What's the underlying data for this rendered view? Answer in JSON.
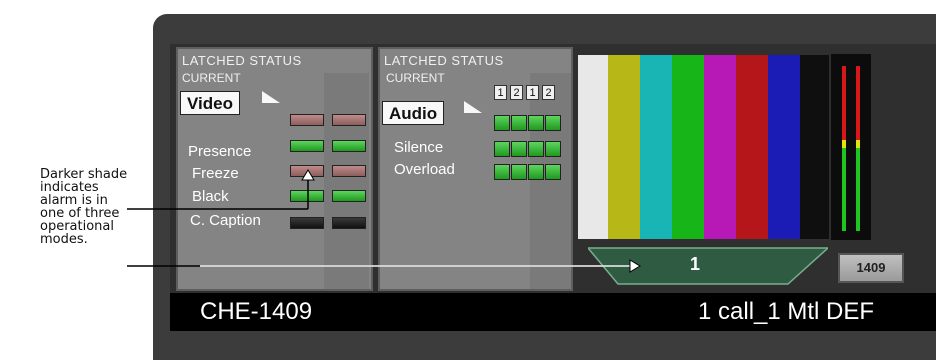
{
  "callout": {
    "lines": [
      "Darker shade",
      "indicates",
      "alarm is in",
      "one of three",
      "operational",
      "modes."
    ]
  },
  "video_panel": {
    "header": "LATCHED STATUS",
    "current": "CURRENT",
    "tab": "Video",
    "rows": [
      "Presence",
      "Freeze",
      "Black",
      "C. Caption"
    ]
  },
  "audio_panel": {
    "header": "LATCHED STATUS",
    "current": "CURRENT",
    "tab": "Audio",
    "channels": [
      "1",
      "2",
      "1",
      "2"
    ],
    "rows": [
      "Silence",
      "Overload"
    ]
  },
  "color_bars": [
    "#e8e8e8",
    "#b7b718",
    "#19b5b5",
    "#17b517",
    "#b619b6",
    "#b5161a",
    "#1b1bb5",
    "#0f0f0f"
  ],
  "channel_display": {
    "value": "1"
  },
  "id_button": {
    "label": "1409"
  },
  "name_bar": {
    "left": "CHE-1409",
    "right": "1 call_1 Mtl DEF"
  },
  "colors": {
    "led_green": "#3fbf3f",
    "led_pink": "#a77474",
    "led_black": "#1e1e1e",
    "meter_red": "#d61818",
    "meter_yellow": "#e2e20e",
    "meter_green": "#20c420"
  }
}
